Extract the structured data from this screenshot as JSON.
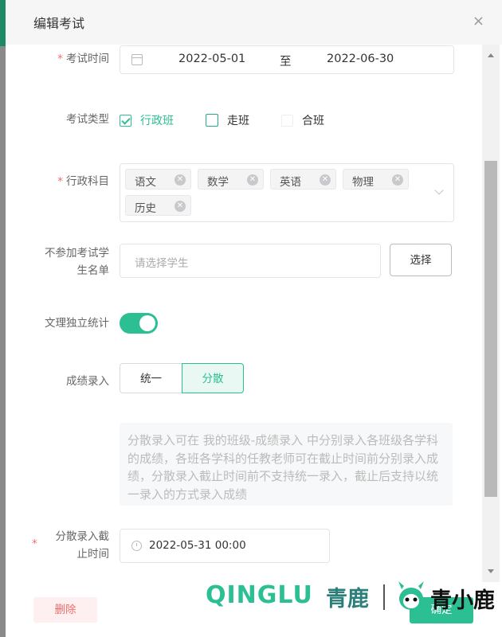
{
  "dialog": {
    "title": "编辑考试",
    "close_icon": "×"
  },
  "form": {
    "exam_time": {
      "required_mark": "*",
      "label": "考试时间",
      "start": "2022-05-01",
      "separator": "至",
      "end": "2022-06-30"
    },
    "exam_type": {
      "label": "考试类型",
      "options": [
        {
          "label": "行政班",
          "checked": true
        },
        {
          "label": "走班",
          "checked": false
        },
        {
          "label": "合班",
          "checked": false
        }
      ]
    },
    "subjects": {
      "required_mark": "*",
      "label": "行政科目",
      "tags": [
        "语文",
        "数学",
        "英语",
        "物理",
        "历史"
      ]
    },
    "excluded_students": {
      "label_line1": "不参加考试学",
      "label_line2": "生名单",
      "placeholder": "请选择学生",
      "button": "选择"
    },
    "separate_stats": {
      "label": "文理独立统计",
      "on": true
    },
    "score_entry": {
      "label": "成绩录入",
      "options": [
        "统一",
        "分散"
      ],
      "selected": "分散"
    },
    "tip": "分散录入可在 我的班级-成绩录入 中分别录入各班级各学科的成绩，各班各学科的任教老师可在截止时间前分别录入成绩，分散录入截止时间前不支持统一录入，截止后支持以统一录入的方式录入成绩",
    "deadline": {
      "required_mark": "*",
      "label_line1": "分散录入截",
      "label_line2": "止时间",
      "value": "2022-05-31 00:00"
    }
  },
  "footer": {
    "delete": "删除",
    "confirm": "确定"
  },
  "watermark": {
    "latin": "QINGLU",
    "cn1": "青鹿",
    "cn2": "青小鹿"
  },
  "colors": {
    "accent": "#2bbf93",
    "danger": "#f56c6c"
  }
}
